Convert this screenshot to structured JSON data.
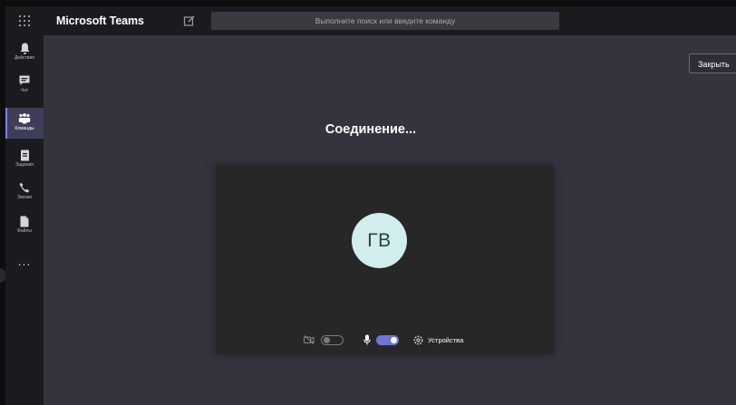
{
  "topbar": {
    "app_title": "Microsoft Teams",
    "search_placeholder": "Выполните поиск или введите команду"
  },
  "rail": {
    "items": [
      {
        "label": "Действия",
        "icon": "bell-icon"
      },
      {
        "label": "Чат",
        "icon": "chat-icon"
      },
      {
        "label": "Команды",
        "icon": "teams-icon",
        "active": true
      },
      {
        "label": "Задания",
        "icon": "assignments-icon"
      },
      {
        "label": "Звонки",
        "icon": "phone-icon"
      },
      {
        "label": "Файлы",
        "icon": "files-icon"
      }
    ],
    "more": "..."
  },
  "main": {
    "close_label": "Закрыть",
    "status": "Соединение...",
    "avatar_initials": "ГВ",
    "controls": {
      "camera_on": false,
      "mic_on": true,
      "devices_label": "Устройства"
    }
  },
  "colors": {
    "background": "#34343f",
    "rail": "#1b1b1f",
    "accent": "#6f75d8",
    "avatar_bg": "#d2eded"
  }
}
